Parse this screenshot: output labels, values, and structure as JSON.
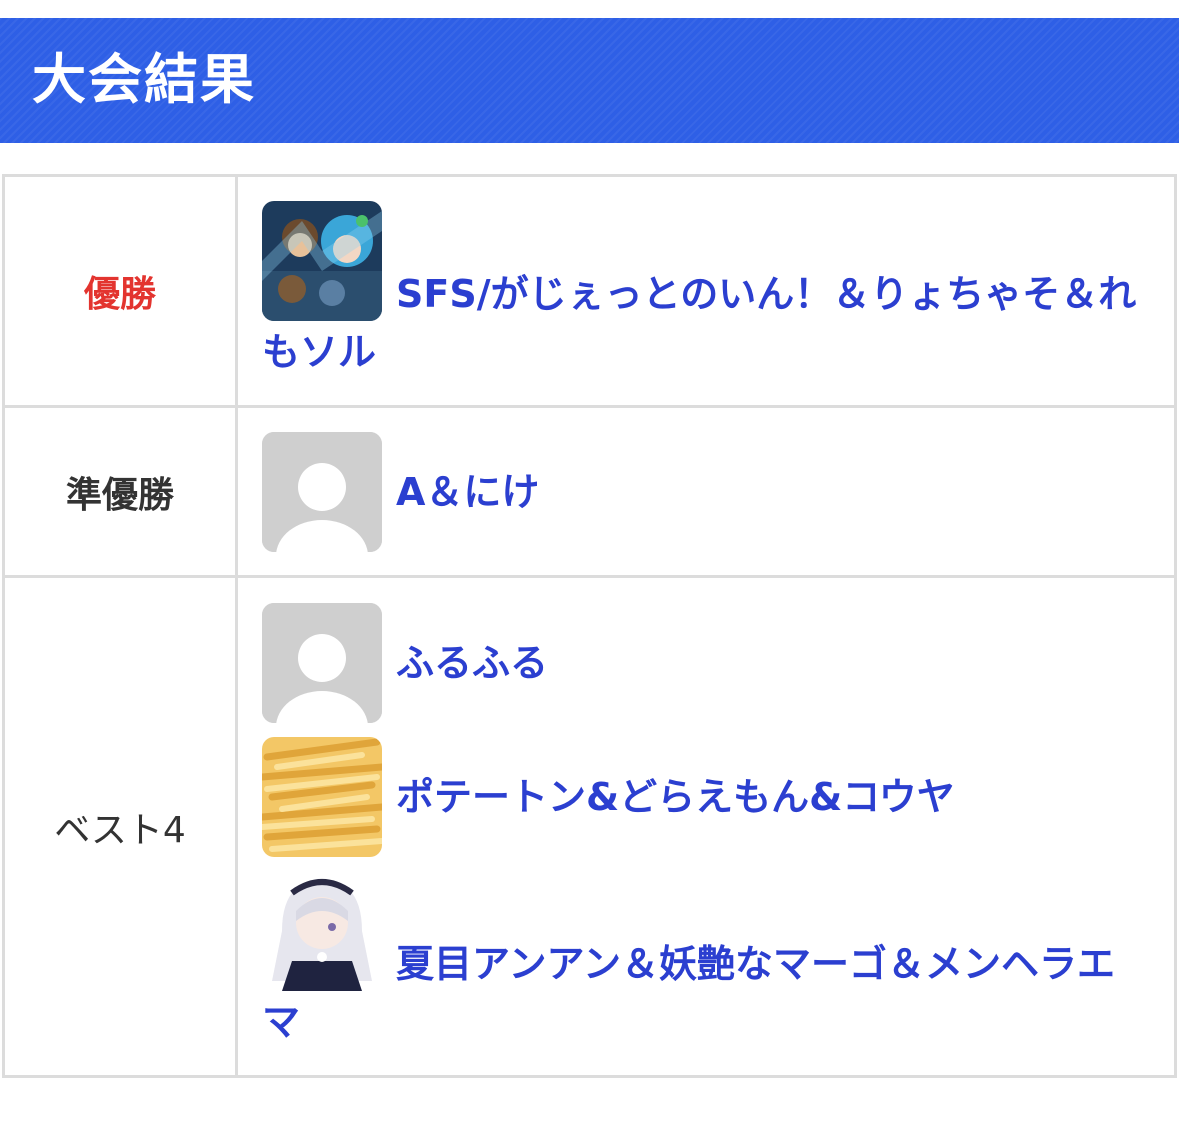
{
  "header": {
    "title": "大会結果"
  },
  "colors": {
    "header_bg": "#2e5fe6",
    "winner_label": "#e3342f",
    "team_link": "#2b3fd0",
    "border": "#dcdcdc"
  },
  "rows": [
    {
      "rank": "優勝",
      "teams": [
        {
          "name": "SFS/がじぇっとのいん！＆りょちゃそ＆れもソル",
          "avatar": "anime-group-avatar"
        }
      ]
    },
    {
      "rank": "準優勝",
      "teams": [
        {
          "name": "A＆にけ",
          "avatar": "default-user-avatar"
        }
      ]
    },
    {
      "rank": "ベスト4",
      "teams": [
        {
          "name": "ふるふる",
          "avatar": "default-user-avatar"
        },
        {
          "name": "ポテートン&どらえもん&コウヤ",
          "avatar": "french-fries-avatar"
        },
        {
          "name": "夏目アンアン＆妖艶なマーゴ＆メンヘラエマ",
          "avatar": "anime-girl-avatar"
        }
      ]
    }
  ]
}
